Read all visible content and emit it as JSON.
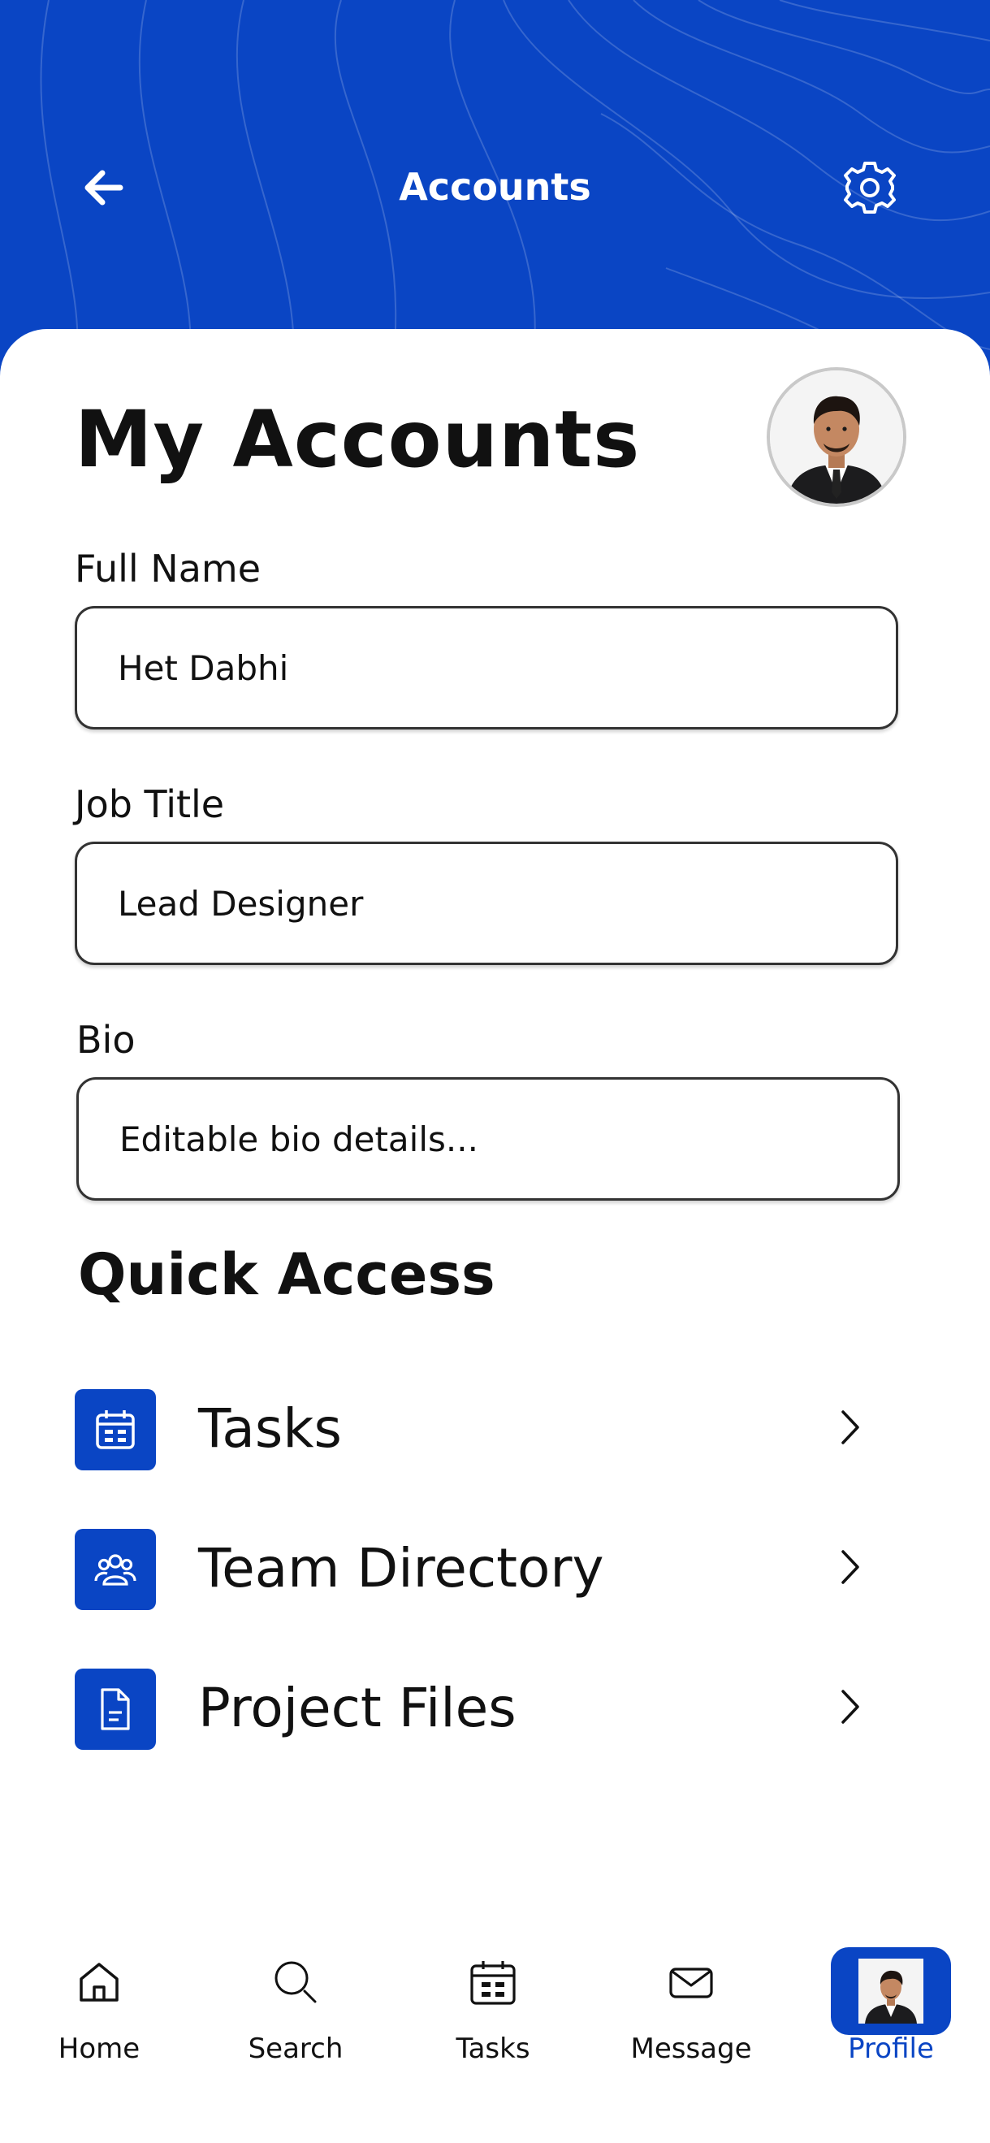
{
  "colors": {
    "brand": "#0a45c4",
    "text": "#111111",
    "border": "#333333"
  },
  "header": {
    "title": "Accounts",
    "back_icon": "arrow-left-icon",
    "settings_icon": "gear-icon"
  },
  "page": {
    "title": "My Accounts",
    "avatar_icon": "user-avatar"
  },
  "form": {
    "full_name": {
      "label": "Full Name",
      "value": "Het Dabhi"
    },
    "job_title": {
      "label": "Job Title",
      "value": "Lead Designer"
    },
    "bio": {
      "label": "Bio",
      "value": "Editable bio details..."
    }
  },
  "quick_access": {
    "title": "Quick Access",
    "items": [
      {
        "label": "Tasks",
        "icon": "calendar-icon"
      },
      {
        "label": "Team Directory",
        "icon": "users-icon"
      },
      {
        "label": "Project Files",
        "icon": "file-icon"
      }
    ]
  },
  "nav": {
    "items": [
      {
        "label": "Home",
        "icon": "home-icon"
      },
      {
        "label": "Search",
        "icon": "search-icon"
      },
      {
        "label": "Tasks",
        "icon": "calendar-icon"
      },
      {
        "label": "Message",
        "icon": "mail-icon"
      },
      {
        "label": "Profile",
        "icon": "profile-avatar",
        "active": true
      }
    ]
  }
}
